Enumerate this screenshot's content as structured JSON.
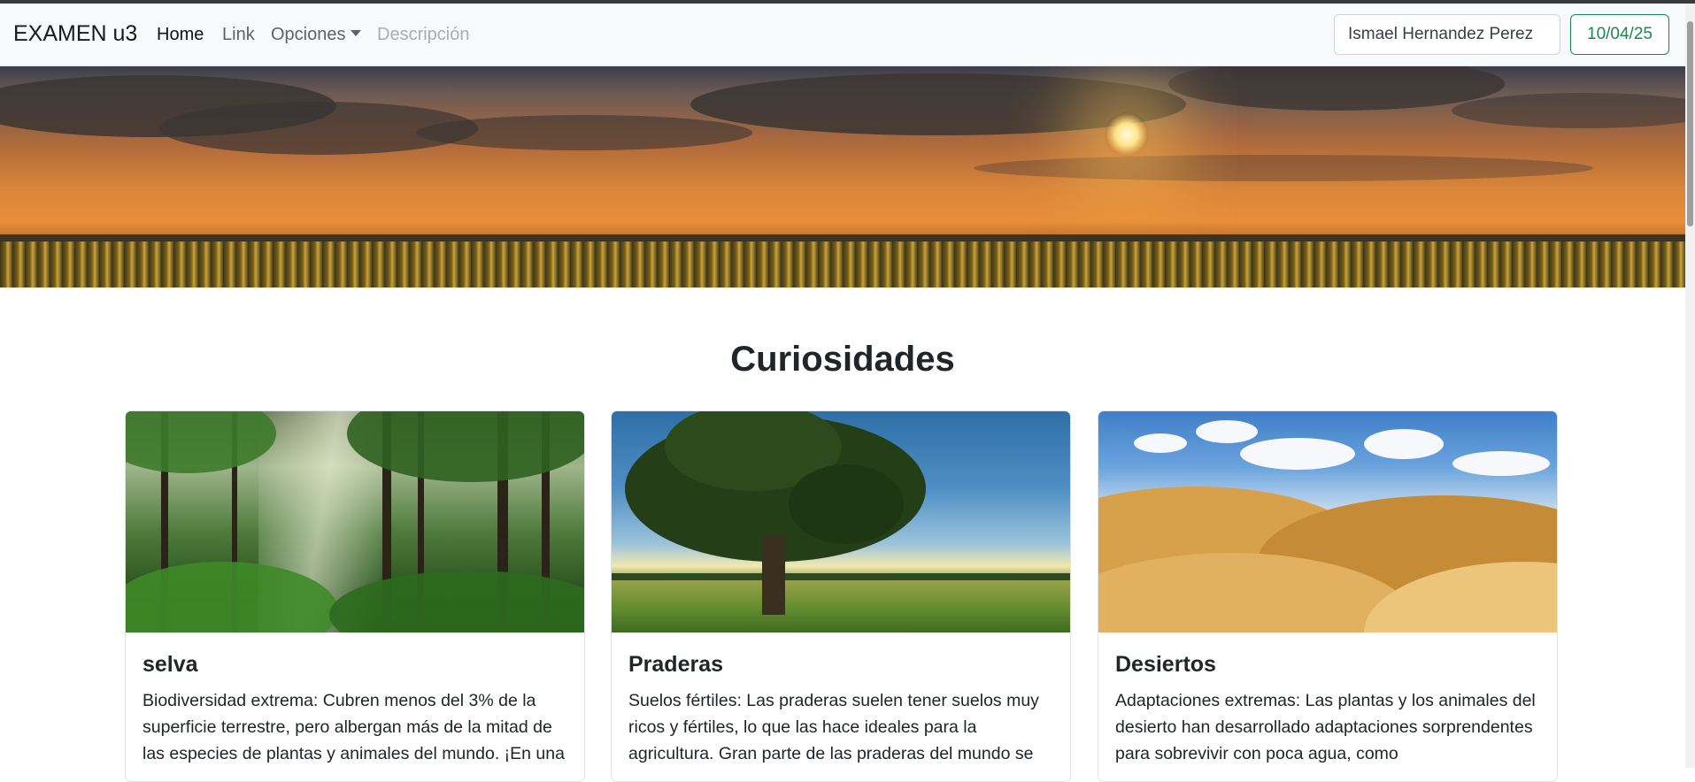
{
  "navbar": {
    "brand": "EXAMEN u3",
    "links": [
      {
        "label": "Home"
      },
      {
        "label": "Link"
      },
      {
        "label": "Opciones"
      },
      {
        "label": "Descripción"
      }
    ],
    "user_field_value": "Ismael Hernandez Perez",
    "date_button": "10/04/25"
  },
  "main": {
    "section_title": "Curiosidades",
    "cards": [
      {
        "title": "selva",
        "text": "Biodiversidad extrema: Cubren menos del 3% de la superficie terrestre, pero albergan más de la mitad de las especies de plantas y animales del mundo. ¡En una"
      },
      {
        "title": "Praderas",
        "text": "Suelos fértiles: Las praderas suelen tener suelos muy ricos y fértiles, lo que las hace ideales para la agricultura. Gran parte de las praderas del mundo se"
      },
      {
        "title": "Desiertos",
        "text": "Adaptaciones extremas: Las plantas y los animales del desierto han desarrollado adaptaciones sorprendentes para sobrevivir con poca agua, como"
      }
    ]
  },
  "colors": {
    "navbar_bg": "#f8f9fa",
    "success": "#198754",
    "text": "#212529"
  }
}
